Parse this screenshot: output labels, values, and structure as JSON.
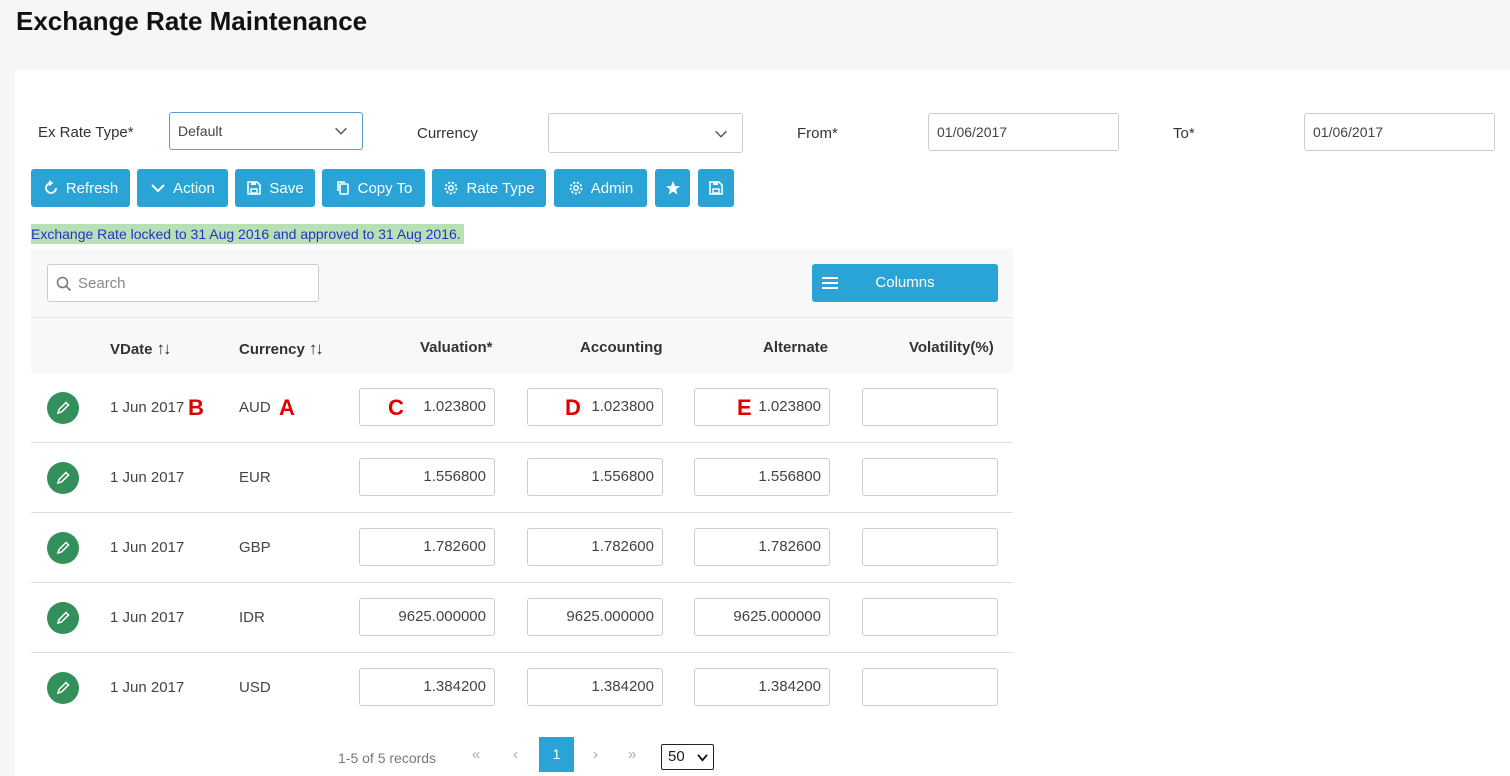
{
  "page": {
    "title": "Exchange Rate Maintenance"
  },
  "filters": {
    "rate_type_label": "Ex Rate Type*",
    "rate_type_value": "Default",
    "currency_label": "Currency",
    "currency_value": "",
    "from_label": "From*",
    "from_value": "01/06/2017",
    "to_label": "To*",
    "to_value": "01/06/2017"
  },
  "toolbar": {
    "refresh": "Refresh",
    "action": "Action",
    "save": "Save",
    "copy_to": "Copy To",
    "rate_type": "Rate Type",
    "admin": "Admin"
  },
  "lock_message": "Exchange Rate locked to 31 Aug 2016 and approved to 31 Aug 2016.",
  "grid": {
    "search_placeholder": "Search",
    "columns_button": "Columns",
    "headers": {
      "vdate": "VDate",
      "currency": "Currency",
      "valuation": "Valuation*",
      "accounting": "Accounting",
      "alternate": "Alternate",
      "volatility": "Volatility(%)"
    },
    "sort_glyph": "↑↓",
    "rows": [
      {
        "vdate": "1 Jun 2017",
        "currency": "AUD",
        "valuation": "1.023800",
        "accounting": "1.023800",
        "alternate": "1.023800",
        "volatility": ""
      },
      {
        "vdate": "1 Jun 2017",
        "currency": "EUR",
        "valuation": "1.556800",
        "accounting": "1.556800",
        "alternate": "1.556800",
        "volatility": ""
      },
      {
        "vdate": "1 Jun 2017",
        "currency": "GBP",
        "valuation": "1.782600",
        "accounting": "1.782600",
        "alternate": "1.782600",
        "volatility": ""
      },
      {
        "vdate": "1 Jun 2017",
        "currency": "IDR",
        "valuation": "9625.000000",
        "accounting": "9625.000000",
        "alternate": "9625.000000",
        "volatility": ""
      },
      {
        "vdate": "1 Jun 2017",
        "currency": "USD",
        "valuation": "1.384200",
        "accounting": "1.384200",
        "alternate": "1.384200",
        "volatility": ""
      }
    ]
  },
  "annotations": {
    "a": "A",
    "b": "B",
    "c": "C",
    "d": "D",
    "e": "E"
  },
  "pagination": {
    "summary": "1-5 of 5 records",
    "first": "«",
    "prev": "‹",
    "next": "›",
    "last": "»",
    "current_page": "1",
    "page_size": "50"
  },
  "colors": {
    "primary": "#2aa3d6",
    "edit_button": "#34905a",
    "lock_highlight": "#b9e0b4",
    "lock_text": "#1f36c4",
    "annotation": "#e00000"
  },
  "icons": [
    "chevron-down-icon",
    "refresh-icon",
    "save-icon",
    "copy-icon",
    "gear-icon",
    "star-icon",
    "search-icon",
    "list-icon",
    "pencil-icon"
  ]
}
